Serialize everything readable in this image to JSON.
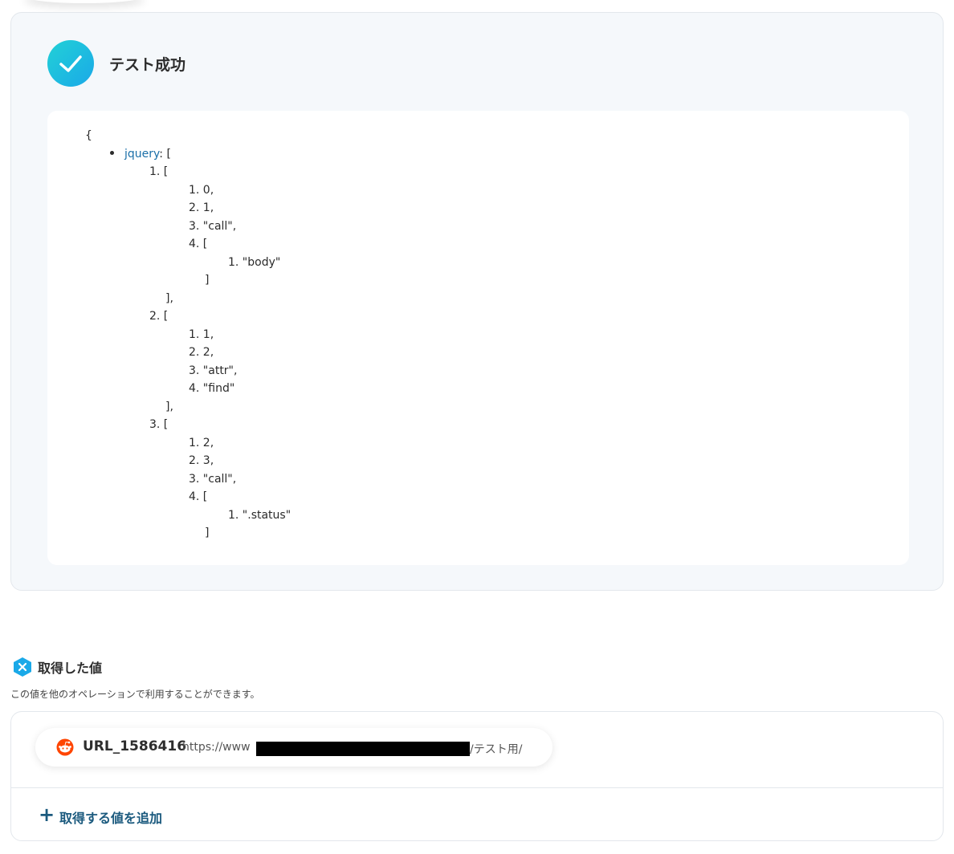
{
  "result": {
    "title": "テスト成功",
    "code_lines": [
      {
        "indent": 0,
        "text": "{"
      },
      {
        "indent": 1,
        "key": "jquery",
        "text": ": ["
      },
      {
        "indent": 2,
        "text": "1. ["
      },
      {
        "indent": 3,
        "text": "1. 0,"
      },
      {
        "indent": 3,
        "text": "2. 1,"
      },
      {
        "indent": 3,
        "text": "3. \"call\","
      },
      {
        "indent": 3,
        "text": "4. ["
      },
      {
        "indent": 4,
        "text": "1. \"body\""
      },
      {
        "indent": 3.4,
        "text": "]"
      },
      {
        "indent": 2.4,
        "text": "],"
      },
      {
        "indent": 2,
        "text": "2. ["
      },
      {
        "indent": 3,
        "text": "1. 1,"
      },
      {
        "indent": 3,
        "text": "2. 2,"
      },
      {
        "indent": 3,
        "text": "3. \"attr\","
      },
      {
        "indent": 3,
        "text": "4. \"find\""
      },
      {
        "indent": 2.4,
        "text": "],"
      },
      {
        "indent": 2,
        "text": "3. ["
      },
      {
        "indent": 3,
        "text": "1. 2,"
      },
      {
        "indent": 3,
        "text": "2. 3,"
      },
      {
        "indent": 3,
        "text": "3. \"call\","
      },
      {
        "indent": 3,
        "text": "4. ["
      },
      {
        "indent": 4,
        "text": "1. \".status\""
      },
      {
        "indent": 3.4,
        "text": "]"
      }
    ]
  },
  "values": {
    "title": "取得した値",
    "description": "この値を他のオペレーションで利用することができます。",
    "item": {
      "name": "URL_1586416",
      "url_prefix": "https://www",
      "url_suffix": "/テスト用/"
    },
    "add_label": "取得する値を追加"
  },
  "colors": {
    "accent": "#1aa9e8",
    "key": "#1b6fa8",
    "add_link": "#1b5a7e",
    "panel_bg": "#f5f8fb"
  },
  "icons": {
    "success": "check-icon",
    "values": "variable-icon",
    "chip": "reddit-icon",
    "add": "plus-icon"
  }
}
